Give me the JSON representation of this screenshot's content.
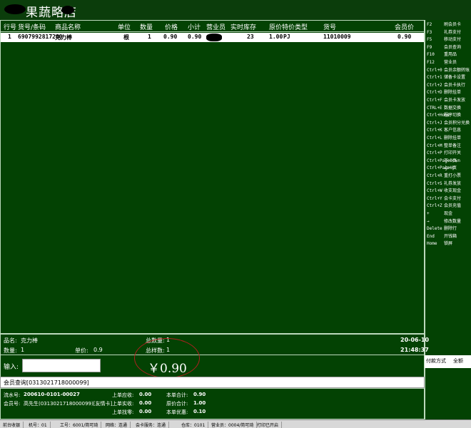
{
  "title": {
    "store_name": "果蔬略店"
  },
  "table": {
    "headers": [
      "行号",
      "货号/条码",
      "商品名称",
      "单位",
      "数量",
      "价格",
      "小计",
      "营业员",
      "实时库存",
      "原价",
      "特价类型",
      "货号",
      "会员价"
    ],
    "rows": [
      {
        "line": "1",
        "barcode": "6907992817200",
        "name": "克力棒",
        "unit": "根",
        "qty": "1",
        "price": "0.90",
        "subtotal": "0.90",
        "clerk": "",
        "stock": "23",
        "orig_price": "1.00",
        "promo_type": "PJ",
        "sku": "11010009",
        "member_price": "0.90"
      }
    ]
  },
  "shortcuts": [
    {
      "key": "F2",
      "label": "刷会员卡"
    },
    {
      "key": "F3",
      "label": "礼券支付"
    },
    {
      "key": "F5",
      "label": "移动支付"
    },
    {
      "key": "F9",
      "label": "会员查询"
    },
    {
      "key": "F10",
      "label": "重用品"
    },
    {
      "key": "F12",
      "label": "营业员"
    },
    {
      "key": "Ctrl+0",
      "label": "会员余额转账"
    },
    {
      "key": "Ctrl+1",
      "label": "储备卡设置"
    },
    {
      "key": "Ctrl+2",
      "label": "会员卡执行"
    },
    {
      "key": "Ctrl+D",
      "label": "删除挂单"
    },
    {
      "key": "Ctrl+F",
      "label": "会员卡发放"
    },
    {
      "key": "CTRL+E",
      "label": "数据交换"
    },
    {
      "key": "Ctrl+Home",
      "label": "程序切换"
    },
    {
      "key": "Ctrl+J",
      "label": "会员积分兑换"
    },
    {
      "key": "Ctrl+K",
      "label": "客户信息"
    },
    {
      "key": "Ctrl+L",
      "label": "删除挂单"
    },
    {
      "key": "Ctrl+M",
      "label": "整单备注"
    },
    {
      "key": "Ctrl+P",
      "label": "打印开关"
    },
    {
      "key": "Ctrl+PageDown",
      "label": "下一页"
    },
    {
      "key": "Ctrl+PageUp",
      "label": "上一页"
    },
    {
      "key": "Ctrl+R",
      "label": "重打小票"
    },
    {
      "key": "Ctrl+S",
      "label": "礼券发放"
    },
    {
      "key": "Ctrl+W",
      "label": "收支现金"
    },
    {
      "key": "Ctrl+Y",
      "label": "会卡支付"
    },
    {
      "key": "Ctrl+Z",
      "label": "会员充值"
    },
    {
      "key": "+",
      "label": "现金"
    },
    {
      "key": "→",
      "label": "修改数量"
    },
    {
      "key": "Delete",
      "label": "删除行"
    },
    {
      "key": "End",
      "label": "开钱箱"
    },
    {
      "key": "Home",
      "label": "锁屏"
    }
  ],
  "info": {
    "product_label": "品名:",
    "product_value": "克力棒",
    "qty_label": "数量:",
    "qty_value": "1",
    "unit_price_label": "单价:",
    "unit_price_value": "0.9",
    "total_qty_label": "总数量:",
    "total_qty_value": "1",
    "total_kinds_label": "总样数:",
    "total_kinds_value": "1",
    "date": "20-06-10",
    "time": "21:48:37"
  },
  "input": {
    "label": "输入:",
    "value": ""
  },
  "total_amount": "￥0.90",
  "payment": {
    "method_tab": "付款方式",
    "all_tab": "全额"
  },
  "member_query": "会员查询[0313021718000099]",
  "summary": {
    "flow_label": "流水号:",
    "flow_value": "200610-0101-00027",
    "member_label": "会员号:",
    "member_value": "高先生(0313021718000099)[友情卡]",
    "last_due_label": "上单应收:",
    "last_due_value": "0.00",
    "last_paid_label": "上单实收:",
    "last_paid_value": "0.00",
    "last_change_label": "上单找零:",
    "last_change_value": "0.00",
    "this_total_label": "本单合计:",
    "this_total_value": "0.90",
    "this_orig_label": "原价合计:",
    "this_orig_value": "1.00",
    "this_discount_label": "本单优惠:",
    "this_discount_value": "0.10"
  },
  "status": [
    "前台收银",
    "机号：01",
    "工号：6001/简可琦",
    "网络：连通",
    "会卡服务：连通",
    "仓库：0101",
    "营业员：0004/简可琦",
    "打印已开启"
  ]
}
